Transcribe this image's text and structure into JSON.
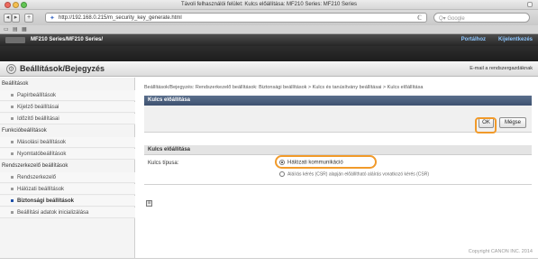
{
  "window": {
    "title": "Távoli felhasználói felület: Kulcs előállítása: MF210 Series: MF210 Series"
  },
  "toolbar": {
    "back": "◂",
    "forward": "▸",
    "add": "+",
    "url": "http://192.168.0.215/m_security_key_generate.html",
    "reload": "ℂ",
    "search_placeholder": "Q▾ Google"
  },
  "bookmarks": {
    "items": [
      "▭",
      "▤",
      "▦"
    ]
  },
  "product": {
    "name": "MF210 Series/MF210 Series/",
    "portal": "Portálhoz",
    "logout": "Kijelentkezés"
  },
  "section": {
    "title": "Beállítások/Bejegyzés",
    "mail": "E-mail a rendszergazdáknak"
  },
  "sidebar": {
    "groups": [
      {
        "title": "Beállítások",
        "items": [
          "Papírbeállítások",
          "Kijelző beállításai",
          "Időzítő beállításai"
        ]
      },
      {
        "title": "Funkcióbeállítások",
        "items": [
          "Másolási beállítások",
          "Nyomtatóbeállítások"
        ]
      },
      {
        "title": "Rendszerkezelő beállítások",
        "items": [
          "Rendszerkezelő",
          "Hálózati beállítások",
          "Biztonsági beállítások",
          "Beállítási adatok inicializálása"
        ]
      }
    ]
  },
  "main": {
    "breadcrumb": "Beállítások/Bejegyzés: Rendszerkezelő beállítások: Biztonsági beállítások > Kulcs és tanúsítvány beállításai > Kulcs előállítása",
    "panel_title": "Kulcs előállítása",
    "ok": "OK",
    "cancel": "Mégse",
    "form_title": "Kulcs előállítása",
    "key_type_label": "Kulcs típusa:",
    "option_network": "Hálózati kommunikáció",
    "option_csr": "Aláírás kérés (CSR) alapján előállítható aláírás vonatkozó kérés (CSR)",
    "note_icon": "≡"
  },
  "footer": {
    "copyright": "Copyright CANON INC. 2014"
  }
}
